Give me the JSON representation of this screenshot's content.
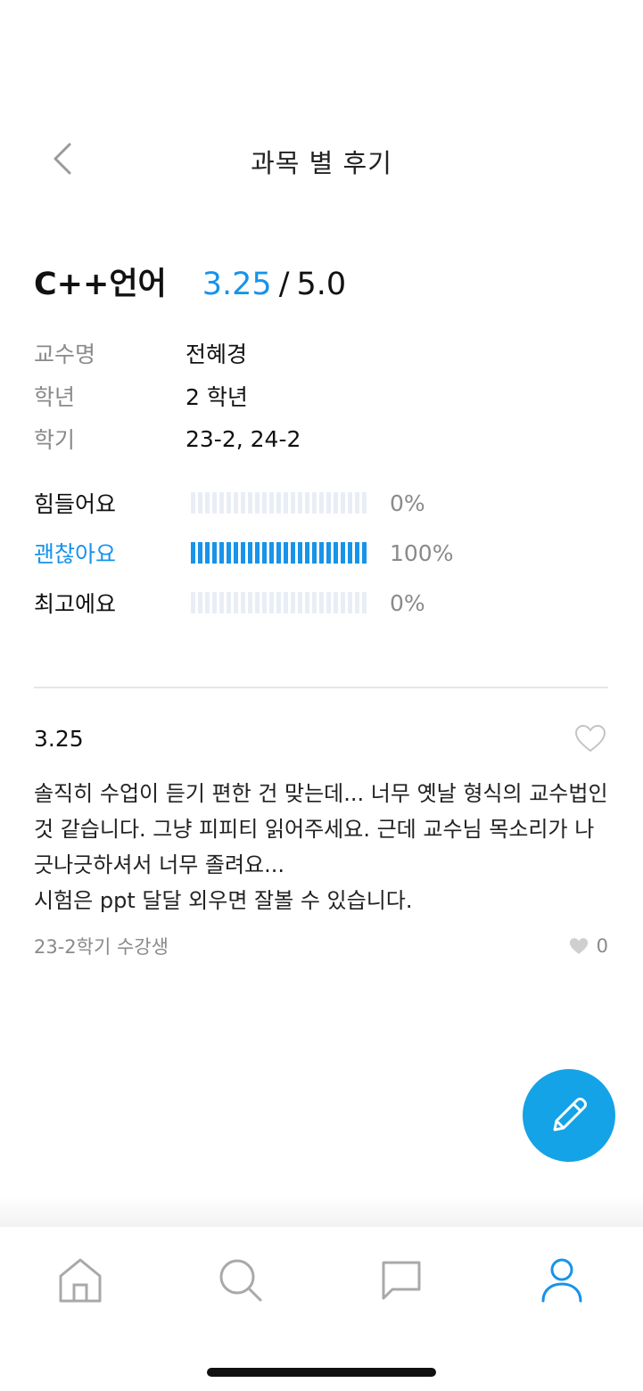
{
  "header": {
    "title": "과목 별 후기"
  },
  "course": {
    "name": "C++언어",
    "score": "3.25",
    "separator": "/",
    "max_score": "5.0"
  },
  "info": [
    {
      "label": "교수명",
      "value": "전혜경"
    },
    {
      "label": "학년",
      "value": "2 학년"
    },
    {
      "label": "학기",
      "value": "23-2, 24-2"
    }
  ],
  "ratings": [
    {
      "label": "힘들어요",
      "percent_text": "0%",
      "percent": 0
    },
    {
      "label": "괜찮아요",
      "percent_text": "100%",
      "percent": 100
    },
    {
      "label": "최고에요",
      "percent_text": "0%",
      "percent": 0
    }
  ],
  "review": {
    "score": "3.25",
    "body": "솔직히 수업이 듣기 편한 건 맞는데... 너무 옛날 형식의 교수법인 것 같습니다. 그냥 피피티 읽어주세요. 근데 교수님 목소리가 나긋나긋하셔서 너무 졸려요...\n시험은 ppt 달달 외우면 잘볼 수 있습니다.",
    "meta": "23-2학기 수강생",
    "like_count": "0"
  },
  "colors": {
    "accent": "#1793ea",
    "fab": "#14a3e6",
    "bar_empty": "#e9eef6",
    "muted": "#8a8a8a"
  },
  "nav": {
    "items": [
      {
        "icon": "home-icon",
        "active": false
      },
      {
        "icon": "search-icon",
        "active": false
      },
      {
        "icon": "chat-icon",
        "active": false
      },
      {
        "icon": "profile-icon",
        "active": true
      }
    ]
  }
}
